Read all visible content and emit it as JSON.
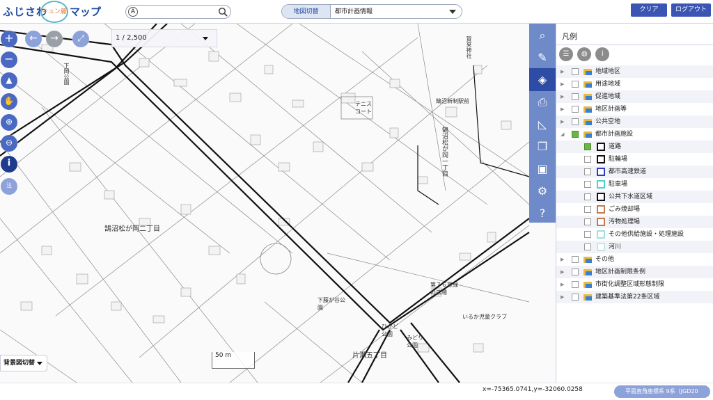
{
  "header": {
    "logo_left": "ふじさわ",
    "logo_mark": "キュン藤",
    "logo_right": "マップ",
    "search_badge": "A",
    "search_placeholder": "",
    "map_switch_label": "地図切替",
    "map_switch_value": "都市計画情報",
    "clear_label": "クリア",
    "logout_label": "ログアウト"
  },
  "map": {
    "scale_value": "1 / 2,500",
    "bg_switch_label": "背景図切替",
    "scale_ruler_label": "50 m",
    "labels": [
      "下岡公園",
      "鵠沼松が岡二丁目",
      "テニスコート",
      "鵠沼新制駅前",
      "鵠沼松が岡一丁目",
      "賀来神社",
      "第７６号緑の広場",
      "下藤が谷公園",
      "いるか児童クラブ",
      "片瀬五丁目",
      "みどり公園",
      "ひかど公園"
    ]
  },
  "rail": {
    "icons": [
      "search-icon",
      "pencil-icon",
      "layers-icon",
      "print-icon",
      "ruler-icon",
      "windows-icon",
      "toolbox-icon",
      "gear-icon",
      "help-icon"
    ]
  },
  "panel": {
    "title": "凡例",
    "tree": [
      {
        "label": "地域地区",
        "expanded": false,
        "checked": false
      },
      {
        "label": "用途地域",
        "expanded": false,
        "checked": false
      },
      {
        "label": "促進地域",
        "expanded": false,
        "checked": false
      },
      {
        "label": "地区計画等",
        "expanded": false,
        "checked": false
      },
      {
        "label": "公共空地",
        "expanded": false,
        "checked": false
      },
      {
        "label": "都市計画施設",
        "expanded": true,
        "checked": true
      }
    ],
    "children": [
      {
        "label": "道路",
        "checked": true,
        "color": "#111111"
      },
      {
        "label": "駐輪場",
        "checked": false,
        "color": "#111111"
      },
      {
        "label": "都市高速鉄道",
        "checked": false,
        "color": "#2d3fbf"
      },
      {
        "label": "駐車場",
        "checked": false,
        "color": "#4fd0d6"
      },
      {
        "label": "公共下水道区域",
        "checked": false,
        "color": "#111111"
      },
      {
        "label": "ごみ焼却場",
        "checked": false,
        "color": "#c27a4a"
      },
      {
        "label": "汚物処理場",
        "checked": false,
        "color": "#c27a4a"
      },
      {
        "label": "その他供給施設・処理施設",
        "checked": false,
        "color": "#9fe0df"
      },
      {
        "label": "河川",
        "checked": false,
        "color": "#c4e7df"
      }
    ],
    "tail": [
      {
        "label": "その他",
        "checked": false
      },
      {
        "label": "地区計画制限条例",
        "checked": false
      },
      {
        "label": "市街化調整区域形態制限",
        "checked": false
      },
      {
        "label": "建築基準法第22条区域",
        "checked": false
      }
    ]
  },
  "footer": {
    "coords": "x=-75365.0741,y=-32060.0258",
    "crs": "平面直角座標系 9系（JGD20"
  },
  "colors": {
    "accent": "#3a55b4",
    "rail": "#6f8ac9",
    "rail_active": "#2c4ca6"
  }
}
